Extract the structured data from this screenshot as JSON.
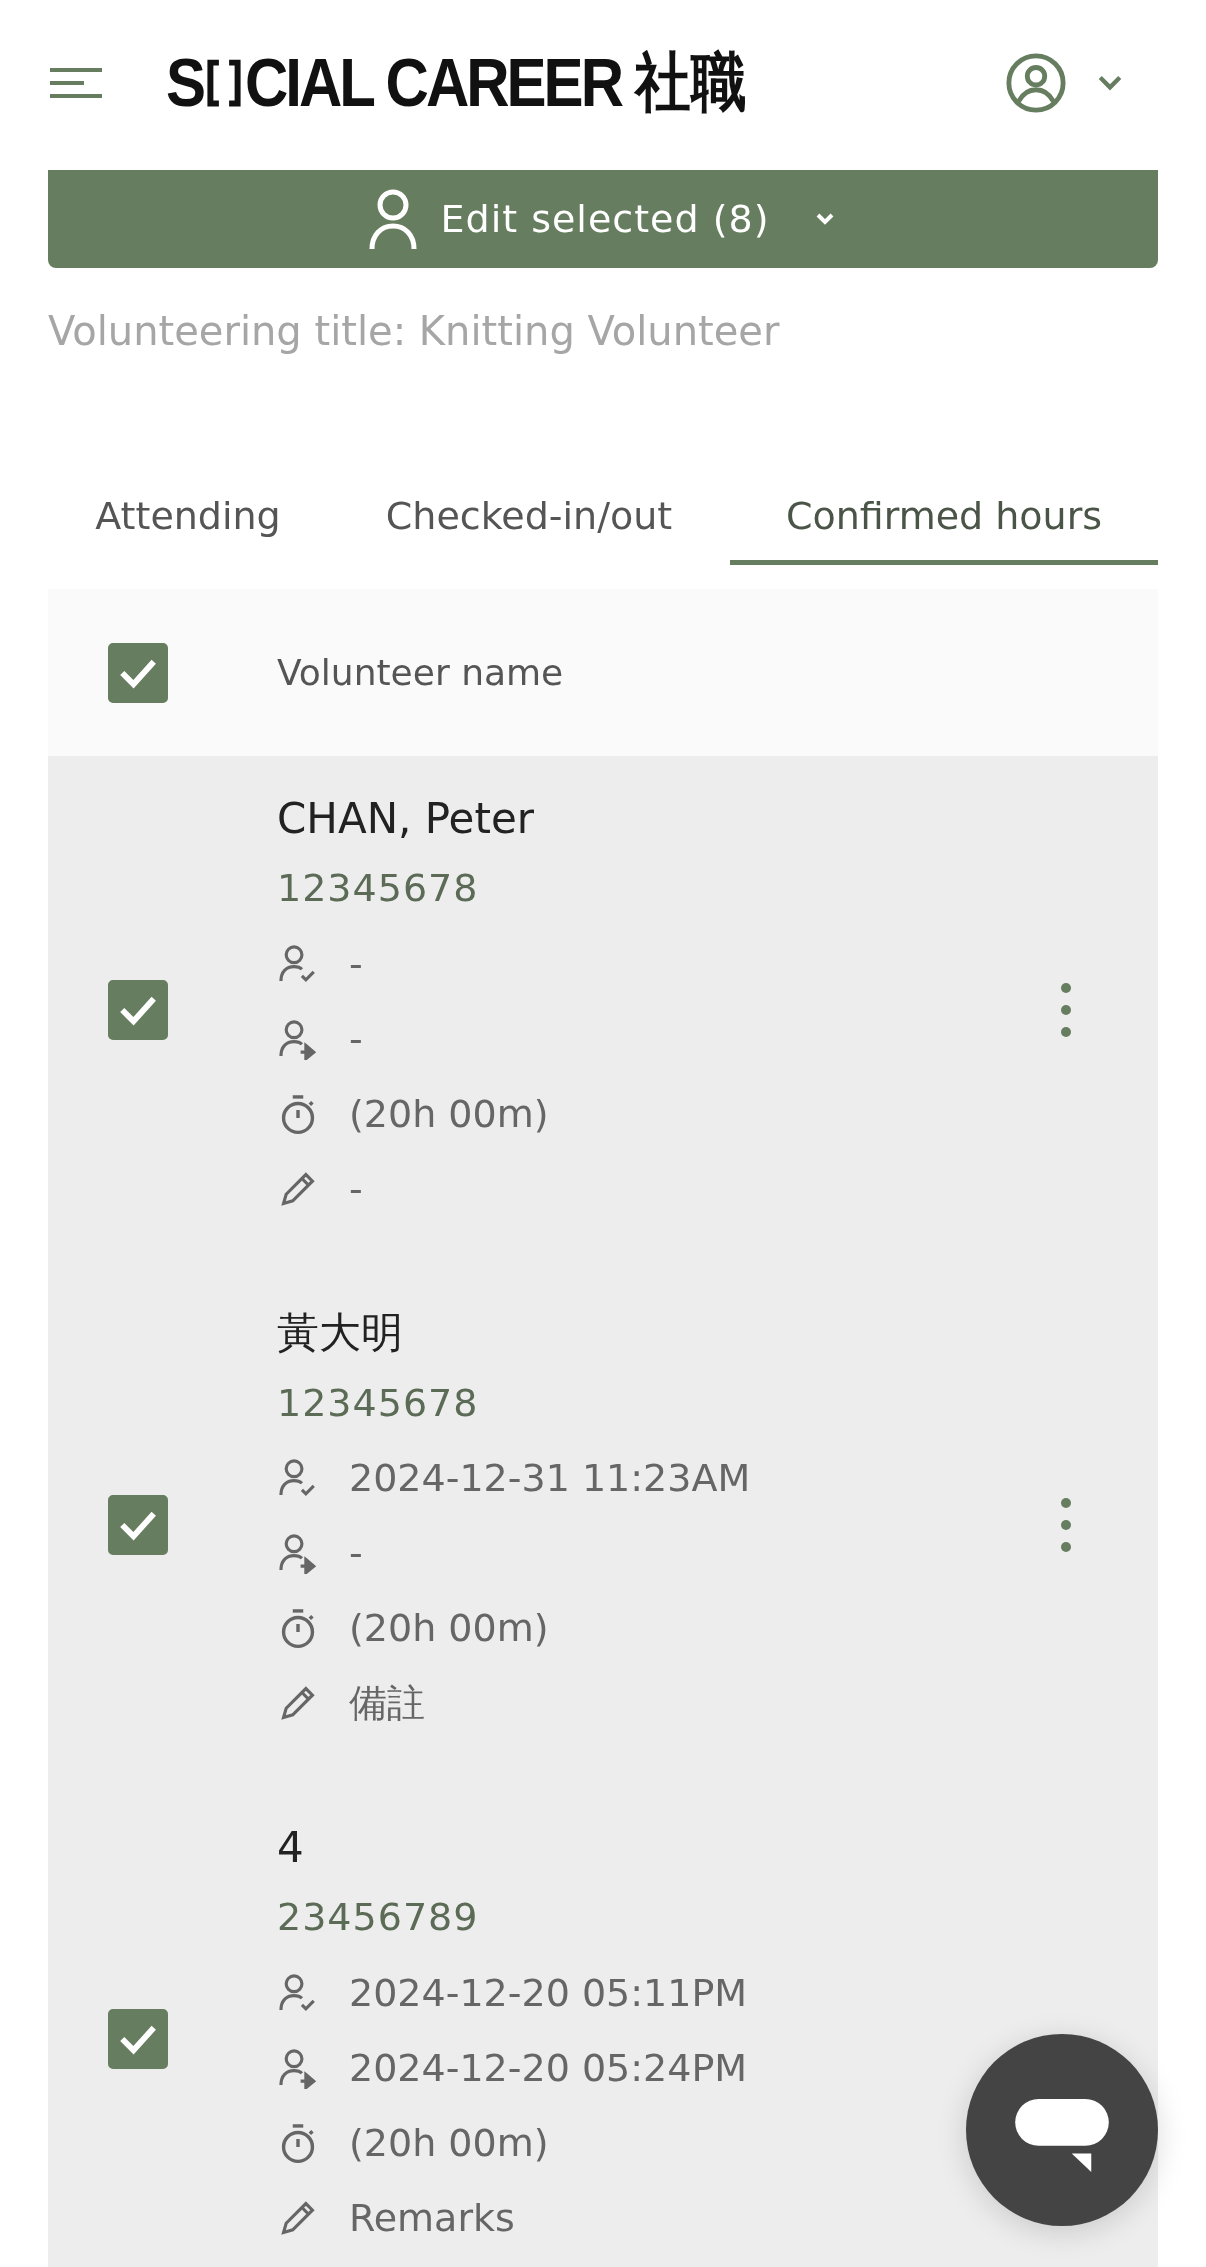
{
  "header": {
    "logo": {
      "start": "S",
      "rest": "CIAL CAREER",
      "cjk": "社職"
    }
  },
  "edit_button": {
    "label": "Edit selected (8)"
  },
  "volunteering_title": "Volunteering title: Knitting Volunteer",
  "tabs": [
    {
      "label": "Attending",
      "selected": false
    },
    {
      "label": "Checked-in/out",
      "selected": false
    },
    {
      "label": "Confirmed hours",
      "selected": true
    }
  ],
  "table": {
    "select_all_checked": true,
    "column": "Volunteer name",
    "rows": [
      {
        "checked": true,
        "more_button": true,
        "name": "CHAN, Peter",
        "id": "12345678",
        "details": [
          {
            "kind": "check_in",
            "text": "-"
          },
          {
            "kind": "check_out",
            "text": "-"
          },
          {
            "kind": "duration",
            "text": "(20h 00m)"
          },
          {
            "kind": "remarks",
            "text": "-"
          }
        ]
      },
      {
        "checked": true,
        "more_button": true,
        "name": "黃大明",
        "id": "12345678",
        "details": [
          {
            "kind": "check_in",
            "text": "2024-12-31 11:23AM"
          },
          {
            "kind": "check_out",
            "text": "-"
          },
          {
            "kind": "duration",
            "text": "(20h 00m)"
          },
          {
            "kind": "remarks",
            "text": "備註"
          }
        ]
      },
      {
        "checked": true,
        "more_button": false,
        "name": "4",
        "id": "23456789",
        "details": [
          {
            "kind": "check_in",
            "text": "2024-12-20 05:11PM"
          },
          {
            "kind": "check_out",
            "text": "2024-12-20 05:24PM"
          },
          {
            "kind": "duration",
            "text": "(20h 00m)"
          },
          {
            "kind": "remarks",
            "text": "Remarks"
          }
        ]
      }
    ]
  }
}
